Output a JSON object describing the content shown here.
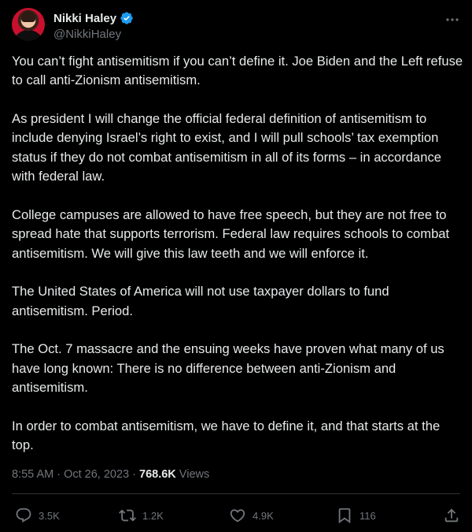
{
  "author": {
    "display_name": "Nikki Haley",
    "handle": "@NikkiHaley",
    "verified": true,
    "avatar_bg": "#c8102e"
  },
  "tweet": {
    "paragraphs": [
      "You can’t fight antisemitism if you can’t define it. Joe Biden and the Left refuse to call anti-Zionism antisemitism.",
      "As president I will change the official federal definition of antisemitism to include denying Israel’s right to exist, and I will pull schools’ tax exemption status if they do not combat antisemitism in all of its forms – in accordance with federal law.",
      "College campuses are allowed to have free speech, but they are not free to spread hate that supports terrorism. Federal law requires schools to combat antisemitism. We will give this law teeth and we will enforce it.",
      "The United States of America will not use taxpayer dollars to fund antisemitism. Period.",
      "The Oct. 7 massacre and the ensuing weeks have proven what many of us have long known: There is no difference between anti-Zionism and antisemitism.",
      "In order to combat antisemitism, we have to define it, and that starts at the top."
    ],
    "time": "8:55 AM",
    "separator": " · ",
    "date": "Oct 26, 2023",
    "views_count": "768.6K",
    "views_label": " Views"
  },
  "actions": {
    "replies": "3.5K",
    "retweets": "1.2K",
    "likes": "4.9K",
    "bookmarks": "116"
  },
  "icons": {
    "verified": "verified-badge-icon",
    "more": "more-icon",
    "reply": "reply-icon",
    "retweet": "retweet-icon",
    "like": "heart-icon",
    "bookmark": "bookmark-icon",
    "share": "share-icon"
  },
  "colors": {
    "background": "#000000",
    "text": "#e7e9ea",
    "muted": "#71767b",
    "verified_blue": "#1d9bf0",
    "divider": "#2f3336"
  }
}
